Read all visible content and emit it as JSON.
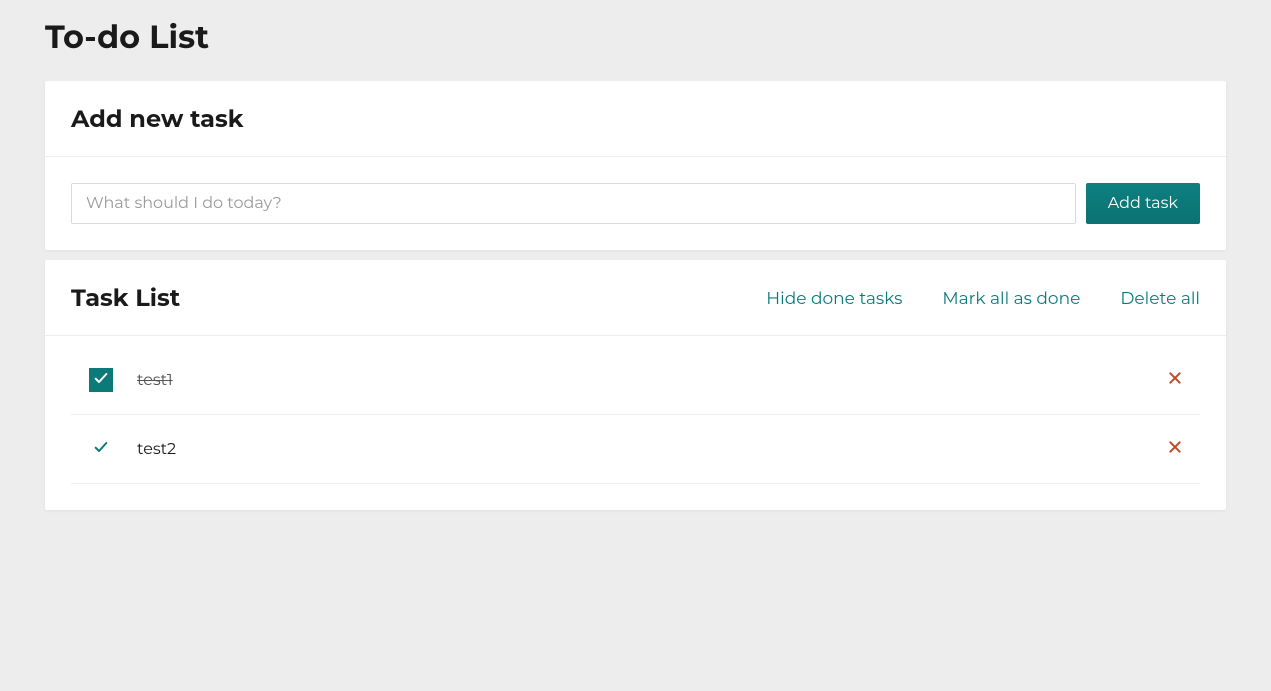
{
  "page": {
    "title": "To-do List"
  },
  "addSection": {
    "heading": "Add new task",
    "input_placeholder": "What should I do today?",
    "button_label": "Add task"
  },
  "listSection": {
    "heading": "Task List",
    "actions": {
      "hide_done": "Hide done tasks",
      "mark_all": "Mark all as done",
      "delete_all": "Delete all"
    },
    "tasks": [
      {
        "label": "test1",
        "done": true
      },
      {
        "label": "test2",
        "done": false
      }
    ]
  }
}
